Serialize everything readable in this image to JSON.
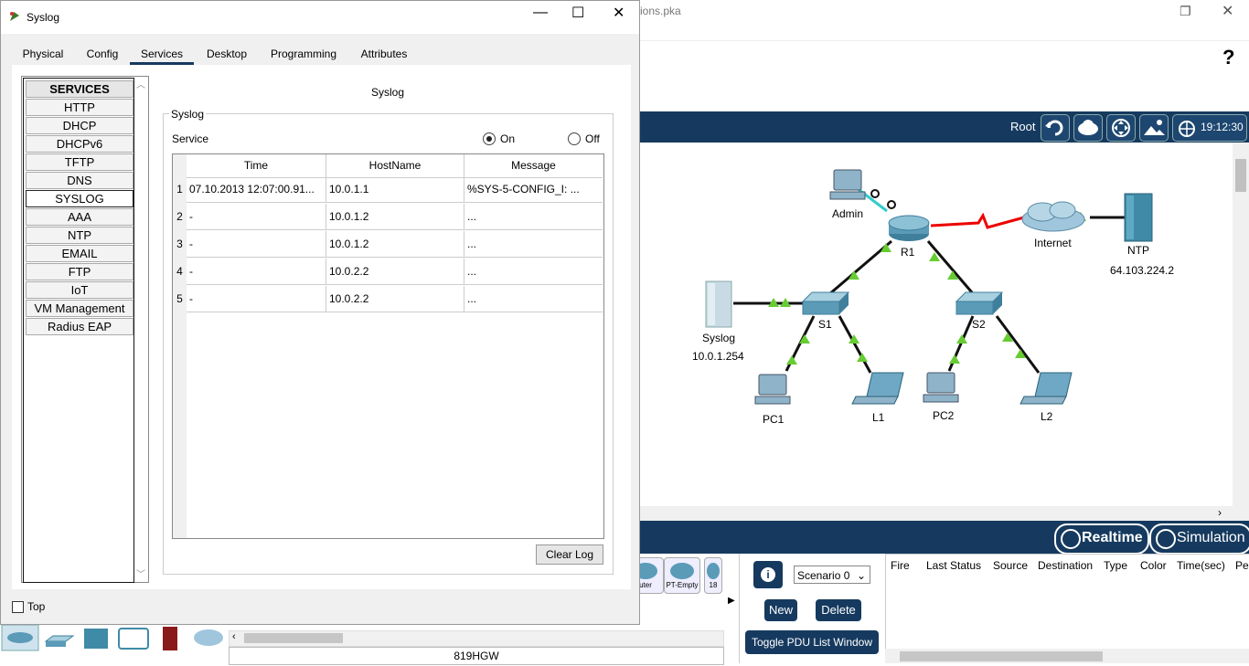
{
  "main_window": {
    "title_fragment": "ions.pka",
    "help_glyph": "?",
    "root_label": "Root",
    "clock": "19:12:30",
    "realtime_label": "Realtime",
    "simulation_label": "Simulation",
    "device_name": "819HGW",
    "pt_icons": [
      "uter",
      "PT-Empty",
      "18"
    ],
    "scenario": "Scenario 0",
    "new_label": "New",
    "delete_label": "Delete",
    "toggle_label": "Toggle PDU List Window",
    "pdu_headers": [
      "Fire",
      "Last Status",
      "Source",
      "Destination",
      "Type",
      "Color",
      "Time(sec)",
      "Pe"
    ]
  },
  "topology": {
    "nodes": {
      "admin": "Admin",
      "r1": "R1",
      "internet": "Internet",
      "ntp": "NTP",
      "ntp_ip": "64.103.224.2",
      "syslog": "Syslog",
      "syslog_ip": "10.0.1.254",
      "s1": "S1",
      "s2": "S2",
      "pc1": "PC1",
      "l1": "L1",
      "pc2": "PC2",
      "l2": "L2"
    }
  },
  "syslog_window": {
    "title": "Syslog",
    "tabs": [
      "Physical",
      "Config",
      "Services",
      "Desktop",
      "Programming",
      "Attributes"
    ],
    "active_tab": "Services",
    "services": [
      "SERVICES",
      "HTTP",
      "DHCP",
      "DHCPv6",
      "TFTP",
      "DNS",
      "SYSLOG",
      "AAA",
      "NTP",
      "EMAIL",
      "FTP",
      "IoT",
      "VM Management",
      "Radius EAP"
    ],
    "selected_service": "SYSLOG",
    "panel_heading": "Syslog",
    "group_label": "Syslog",
    "service_label": "Service",
    "on_label": "On",
    "off_label": "Off",
    "service_state": "On",
    "columns": [
      "Time",
      "HostName",
      "Message"
    ],
    "rows": [
      {
        "n": "1",
        "time": "07.10.2013 12:07:00.91...",
        "host": "10.0.1.1",
        "msg": "%SYS-5-CONFIG_I: ..."
      },
      {
        "n": "2",
        "time": "-",
        "host": "10.0.1.2",
        "msg": "..."
      },
      {
        "n": "3",
        "time": "-",
        "host": "10.0.1.2",
        "msg": "..."
      },
      {
        "n": "4",
        "time": "-",
        "host": "10.0.2.2",
        "msg": "..."
      },
      {
        "n": "5",
        "time": "-",
        "host": "10.0.2.2",
        "msg": "..."
      }
    ],
    "clear_log_label": "Clear Log",
    "top_label": "Top"
  }
}
